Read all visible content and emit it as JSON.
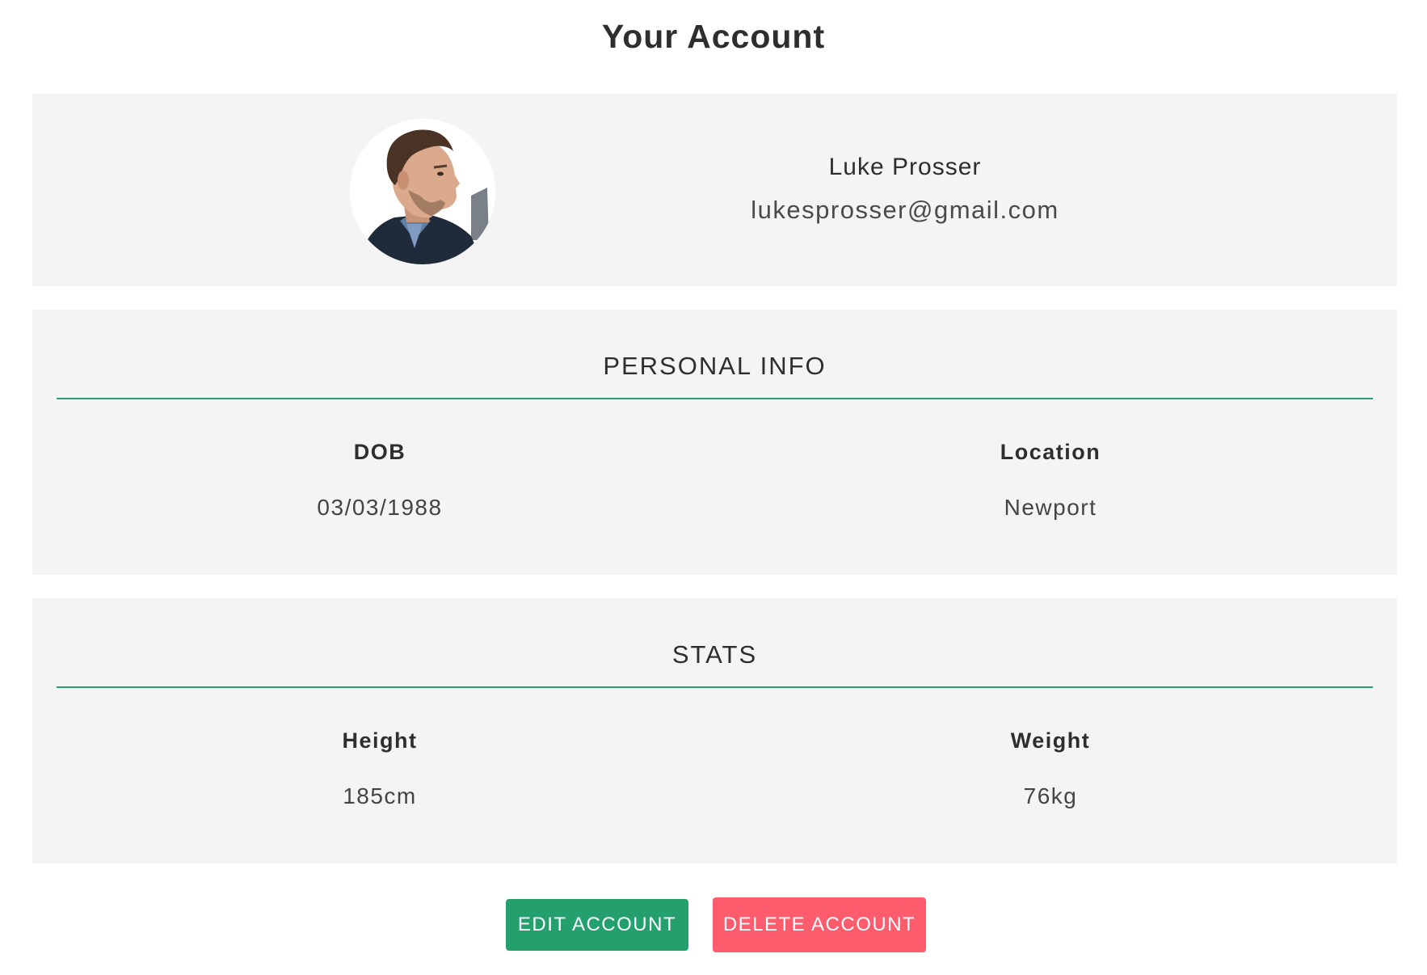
{
  "page": {
    "title": "Your Account"
  },
  "profile": {
    "name": "Luke Prosser",
    "email": "lukesprosser@gmail.com",
    "avatar_icon": "profile-photo"
  },
  "personal_info": {
    "heading": "PERSONAL INFO",
    "fields": [
      {
        "label": "DOB",
        "value": "03/03/1988"
      },
      {
        "label": "Location",
        "value": "Newport"
      }
    ]
  },
  "stats": {
    "heading": "STATS",
    "fields": [
      {
        "label": "Height",
        "value": "185cm"
      },
      {
        "label": "Weight",
        "value": "76kg"
      }
    ]
  },
  "actions": {
    "edit_label": "EDIT ACCOUNT",
    "delete_label": "DELETE ACCOUNT"
  },
  "colors": {
    "accent": "#2a9d76",
    "edit_button": "#24a06f",
    "delete_button": "#fc5c6c",
    "card_background": "#f4f4f4"
  }
}
